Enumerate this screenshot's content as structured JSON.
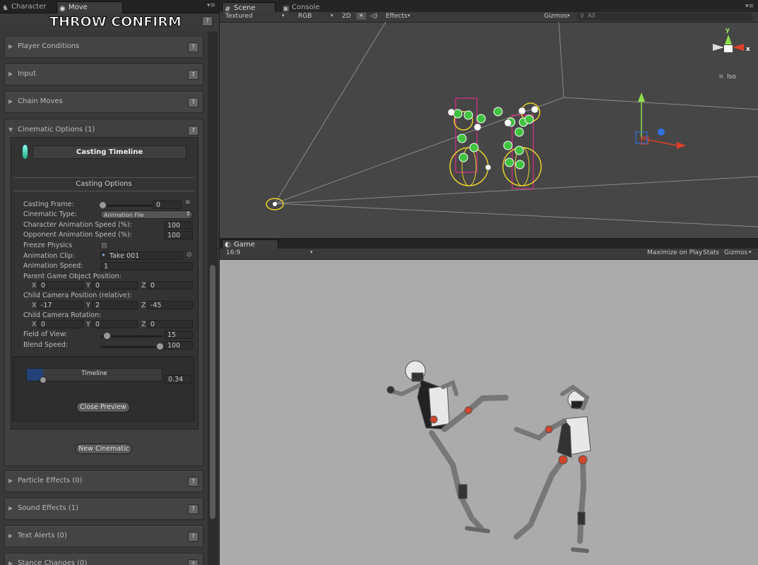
{
  "inspector": {
    "tabs": [
      {
        "label": "Character"
      },
      {
        "label": "Move"
      }
    ],
    "header_title": "THROW CONFIRM",
    "sections_top": [
      "Player Conditions",
      "Input",
      "Chain Moves"
    ],
    "cinematic_title": "Cinematic Options (1)",
    "casting_timeline": "Casting Timeline",
    "casting_options": "Casting Options",
    "fields": {
      "casting_frame": {
        "label": "Casting Frame:",
        "value": "0"
      },
      "cinematic_type": {
        "label": "Cinematic Type:",
        "value": "Animation File"
      },
      "char_anim_speed": {
        "label": "Character Animation Speed (%):",
        "value": "100"
      },
      "opp_anim_speed": {
        "label": "Opponent Animation Speed (%):",
        "value": "100"
      },
      "freeze_physics": {
        "label": "Freeze Physics"
      },
      "animation_clip": {
        "label": "Animation Clip:",
        "value": "Take 001"
      },
      "animation_speed": {
        "label": "Animation Speed:",
        "value": "1"
      },
      "parent_pos": {
        "label": "Parent Game Object Position:",
        "x": "0",
        "y": "0",
        "z": "0"
      },
      "child_cam_pos": {
        "label": "Child Camera Position (relative):",
        "x": "-17",
        "y": "2",
        "z": "-45"
      },
      "child_cam_rot": {
        "label": "Child Camera Rotation:",
        "x": "0",
        "y": "0",
        "z": "0"
      },
      "field_of_view": {
        "label": "Field of View:",
        "value": "15"
      },
      "blend_speed": {
        "label": "Blend Speed:",
        "value": "100"
      }
    },
    "axis": {
      "x": "X",
      "y": "Y",
      "z": "Z"
    },
    "timeline_label": "Timeline",
    "timeline_value": "0.34",
    "timeline_progress": 0.34,
    "close_preview": "Close Preview",
    "new_cinematic": "New Cinematic",
    "sections_bottom": [
      "Particle Effects (0)",
      "Sound Effects (1)",
      "Text Alerts (0)",
      "Stance Changes (0)"
    ],
    "help": "?"
  },
  "scene": {
    "tabs": [
      {
        "label": "Scene"
      },
      {
        "label": "Console"
      }
    ],
    "toolbar": {
      "shading": "Textured",
      "render": "RGB",
      "mode2d": "2D",
      "effects": "Effects",
      "gizmos": "Gizmos",
      "search": "All"
    },
    "gizmo": {
      "y": "y",
      "x": "x",
      "view": "Iso"
    }
  },
  "game": {
    "tab": "Game",
    "toolbar": {
      "aspect": "16:9",
      "maximize": "Maximize on Play",
      "stats": "Stats",
      "gizmos": "Gizmos"
    }
  },
  "colors": {
    "panel": "#383838",
    "scene_bg": "#464646",
    "game_bg": "#ababab",
    "accent_green": "#3fc33f",
    "accent_yellow": "#e8d22a"
  }
}
